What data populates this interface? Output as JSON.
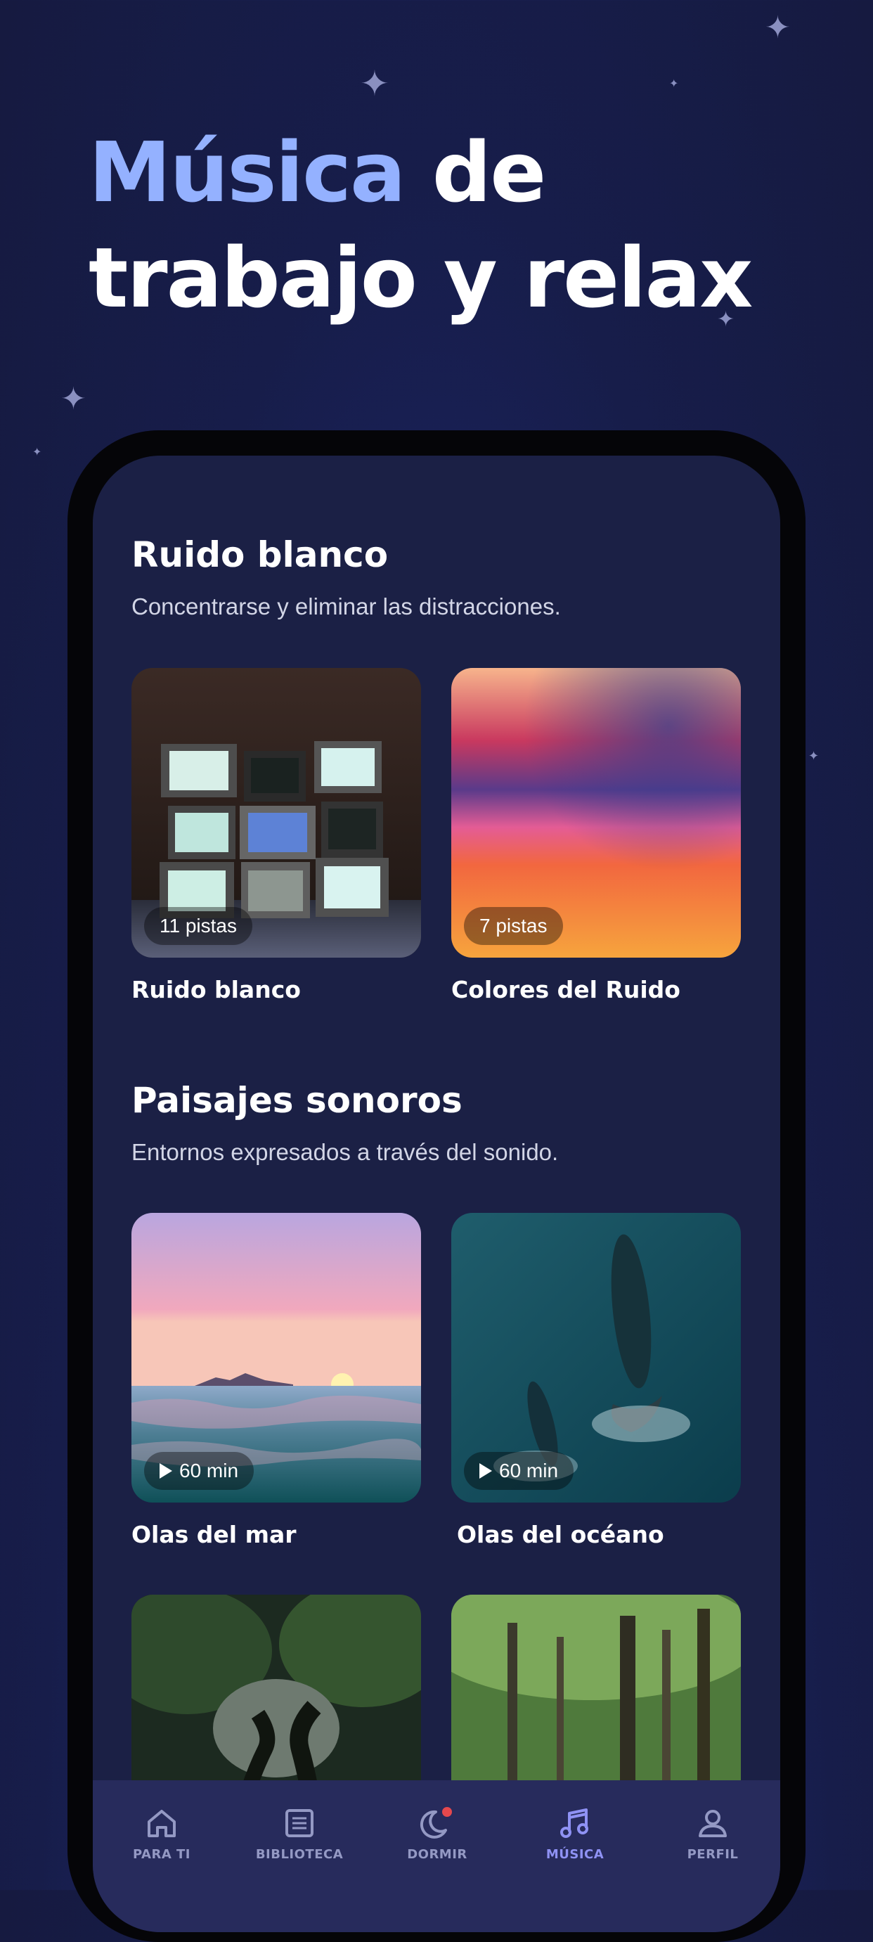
{
  "headline": {
    "accent": "Música",
    "rest_line1": " de",
    "line2": "trabajo y relax"
  },
  "sections": [
    {
      "title": "Ruido blanco",
      "subtitle": "Concentrarse y eliminar las distracciones.",
      "cards": [
        {
          "title": "Ruido blanco",
          "badge": "11 pistas"
        },
        {
          "title": "Colores del Ruido",
          "badge": "7 pistas"
        }
      ]
    },
    {
      "title": "Paisajes sonoros",
      "subtitle": "Entornos expresados a través del sonido.",
      "cards": [
        {
          "title": "Olas del mar",
          "badge": "60 min"
        },
        {
          "title": "Olas del océano",
          "badge": "60 min"
        }
      ]
    }
  ],
  "tabs": [
    {
      "label": "PARA TI",
      "icon": "home-icon"
    },
    {
      "label": "BIBLIOTECA",
      "icon": "library-icon"
    },
    {
      "label": "DORMIR",
      "icon": "moon-icon"
    },
    {
      "label": "MÚSICA",
      "icon": "music-note-icon",
      "active": true
    },
    {
      "label": "PERFIL",
      "icon": "user-icon"
    }
  ],
  "colors": {
    "accent": "#94b1ff",
    "active_tab": "#8f92f4",
    "notification_dot": "#e5484d",
    "screen_bg": "#1b2045"
  }
}
